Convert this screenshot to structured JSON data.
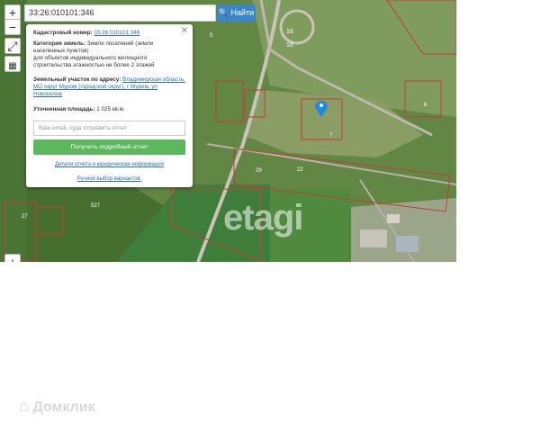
{
  "search": {
    "value": "33:26:010101:346",
    "button_label": "Найти"
  },
  "controls": {
    "zoom_in": "+",
    "zoom_out": "−"
  },
  "popup": {
    "cad_label": "Кадастровый номер:",
    "cad_value": "33:26:010101:346",
    "category_label": "Категория земель:",
    "category_value": "Земли поселений (земли населенных пунктов)",
    "usage": "для объектов индивидуального жилищного строительства этажностью не более 2 этажей",
    "address_label": "Земельный участок по адресу:",
    "address_value": "Владимирская область, МО округ Муром (городской округ), г Муром, ул Новоселов",
    "area_label": "Уточненная площадь:",
    "area_value": "1 025 кв.м.",
    "email_placeholder": "Ваш email, куда отправить отчет",
    "report_button": "Получить подробный отчет",
    "details_link": "Детали отчета и юридическая информация",
    "manual_link": "Ручной выбор вариантов."
  },
  "map_labels": [
    "16",
    "16",
    "29",
    "22",
    "7",
    "527",
    "27",
    "5",
    "6"
  ],
  "watermark": "etagi",
  "brand": "Домклик",
  "colors": {
    "parcel": "#c83a3a",
    "button_blue": "#3a86c8",
    "button_green": "#5cb85c",
    "marker": "#1e88e5"
  }
}
